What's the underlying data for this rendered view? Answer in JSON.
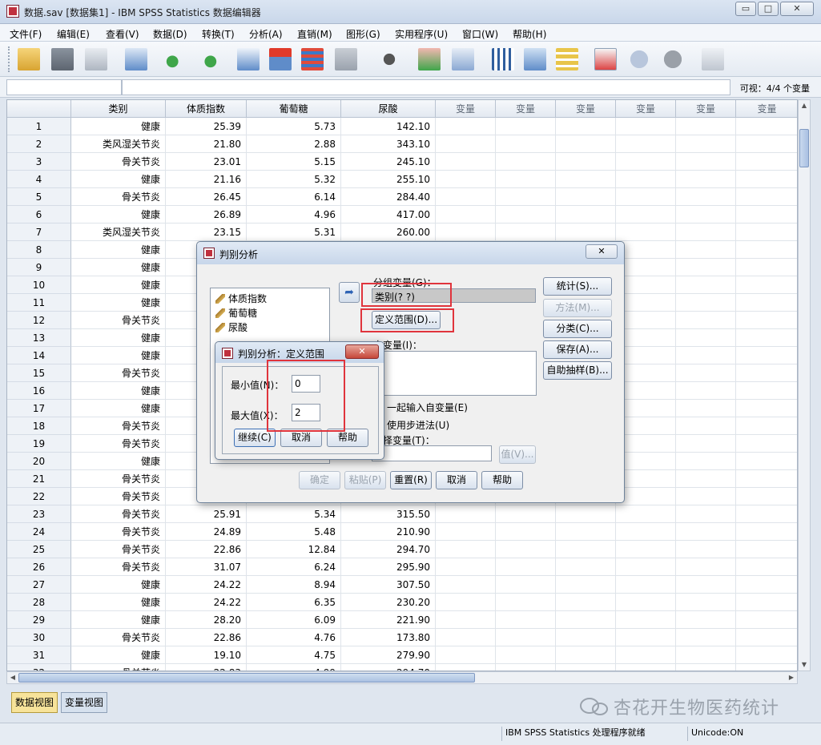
{
  "window": {
    "title": "数据.sav [数据集1] - IBM SPSS Statistics 数据编辑器",
    "minimize": "▭",
    "maximize": "□",
    "close": "✕"
  },
  "menu": [
    "文件(F)",
    "编辑(E)",
    "查看(V)",
    "数据(D)",
    "转换(T)",
    "分析(A)",
    "直销(M)",
    "图形(G)",
    "实用程序(U)",
    "窗口(W)",
    "帮助(H)"
  ],
  "cellbar": {
    "visible": "可视：4/4 个变量"
  },
  "grid": {
    "headers": [
      "类别",
      "体质指数",
      "葡萄糖",
      "尿酸",
      "变量",
      "变量",
      "变量",
      "变量",
      "变量",
      "变量"
    ],
    "rows": [
      [
        "1",
        "健康",
        "25.39",
        "5.73",
        "142.10"
      ],
      [
        "2",
        "类风湿关节炎",
        "21.80",
        "2.88",
        "343.10"
      ],
      [
        "3",
        "骨关节炎",
        "23.01",
        "5.15",
        "245.10"
      ],
      [
        "4",
        "健康",
        "21.16",
        "5.32",
        "255.10"
      ],
      [
        "5",
        "骨关节炎",
        "26.45",
        "6.14",
        "284.40"
      ],
      [
        "6",
        "健康",
        "26.89",
        "4.96",
        "417.00"
      ],
      [
        "7",
        "类风湿关节炎",
        "23.15",
        "5.31",
        "260.00"
      ],
      [
        "8",
        "健康",
        "",
        "",
        ""
      ],
      [
        "9",
        "健康",
        "",
        "",
        ""
      ],
      [
        "10",
        "健康",
        "",
        "",
        ""
      ],
      [
        "11",
        "健康",
        "",
        "",
        ""
      ],
      [
        "12",
        "骨关节炎",
        "",
        "",
        ""
      ],
      [
        "13",
        "健康",
        "",
        "",
        ""
      ],
      [
        "14",
        "健康",
        "",
        "",
        ""
      ],
      [
        "15",
        "骨关节炎",
        "",
        "",
        ""
      ],
      [
        "16",
        "健康",
        "",
        "",
        ""
      ],
      [
        "17",
        "健康",
        "",
        "",
        ""
      ],
      [
        "18",
        "骨关节炎",
        "",
        "",
        ""
      ],
      [
        "19",
        "骨关节炎",
        "",
        "",
        ""
      ],
      [
        "20",
        "健康",
        "",
        "",
        ""
      ],
      [
        "21",
        "骨关节炎",
        "",
        "",
        ""
      ],
      [
        "22",
        "骨关节炎",
        "",
        "",
        ""
      ],
      [
        "23",
        "骨关节炎",
        "25.91",
        "5.34",
        "315.50"
      ],
      [
        "24",
        "骨关节炎",
        "24.89",
        "5.48",
        "210.90"
      ],
      [
        "25",
        "骨关节炎",
        "22.86",
        "12.84",
        "294.70"
      ],
      [
        "26",
        "骨关节炎",
        "31.07",
        "6.24",
        "295.90"
      ],
      [
        "27",
        "健康",
        "24.22",
        "8.94",
        "307.50"
      ],
      [
        "28",
        "健康",
        "24.22",
        "6.35",
        "230.20"
      ],
      [
        "29",
        "健康",
        "28.20",
        "6.09",
        "221.90"
      ],
      [
        "30",
        "骨关节炎",
        "22.86",
        "4.76",
        "173.80"
      ],
      [
        "31",
        "健康",
        "19.10",
        "4.75",
        "279.90"
      ],
      [
        "32",
        "骨关节炎",
        "22.83",
        "4.99",
        "294.70"
      ]
    ]
  },
  "tabs": {
    "data_view": "数据视图",
    "variable_view": "变量视图"
  },
  "watermark": "杏花开生物医药统计",
  "status": {
    "processor": "IBM SPSS Statistics 处理程序就绪",
    "unicode": "Unicode:ON"
  },
  "discriminant": {
    "title": "判别分析",
    "close": "✕",
    "variables": [
      "体质指数",
      "葡萄糖",
      "尿酸"
    ],
    "arrow": "➦",
    "grouping_label": "分组变量(G)：",
    "grouping_value": "类别(? ?)",
    "define_range": "定义范围(D)...",
    "independents_label": "自变量(I)：",
    "enter_together": "一起输入自变量(E)",
    "stepwise": "使用步进法(U)",
    "selection_label": "选择变量(T)：",
    "value_btn": "值(V)...",
    "side_buttons": [
      "统计(S)...",
      "方法(M)...",
      "分类(C)...",
      "保存(A)...",
      "自助抽样(B)..."
    ],
    "bottom_buttons": [
      "确定",
      "粘贴(P)",
      "重置(R)",
      "取消",
      "帮助"
    ]
  },
  "define_range": {
    "title": "判别分析：定义范围",
    "close": "✕",
    "min_label": "最小值(N)：",
    "min_value": "0",
    "max_label": "最大值(X)：",
    "max_value": "2",
    "continue": "继续(C)",
    "cancel": "取消",
    "help": "帮助"
  }
}
